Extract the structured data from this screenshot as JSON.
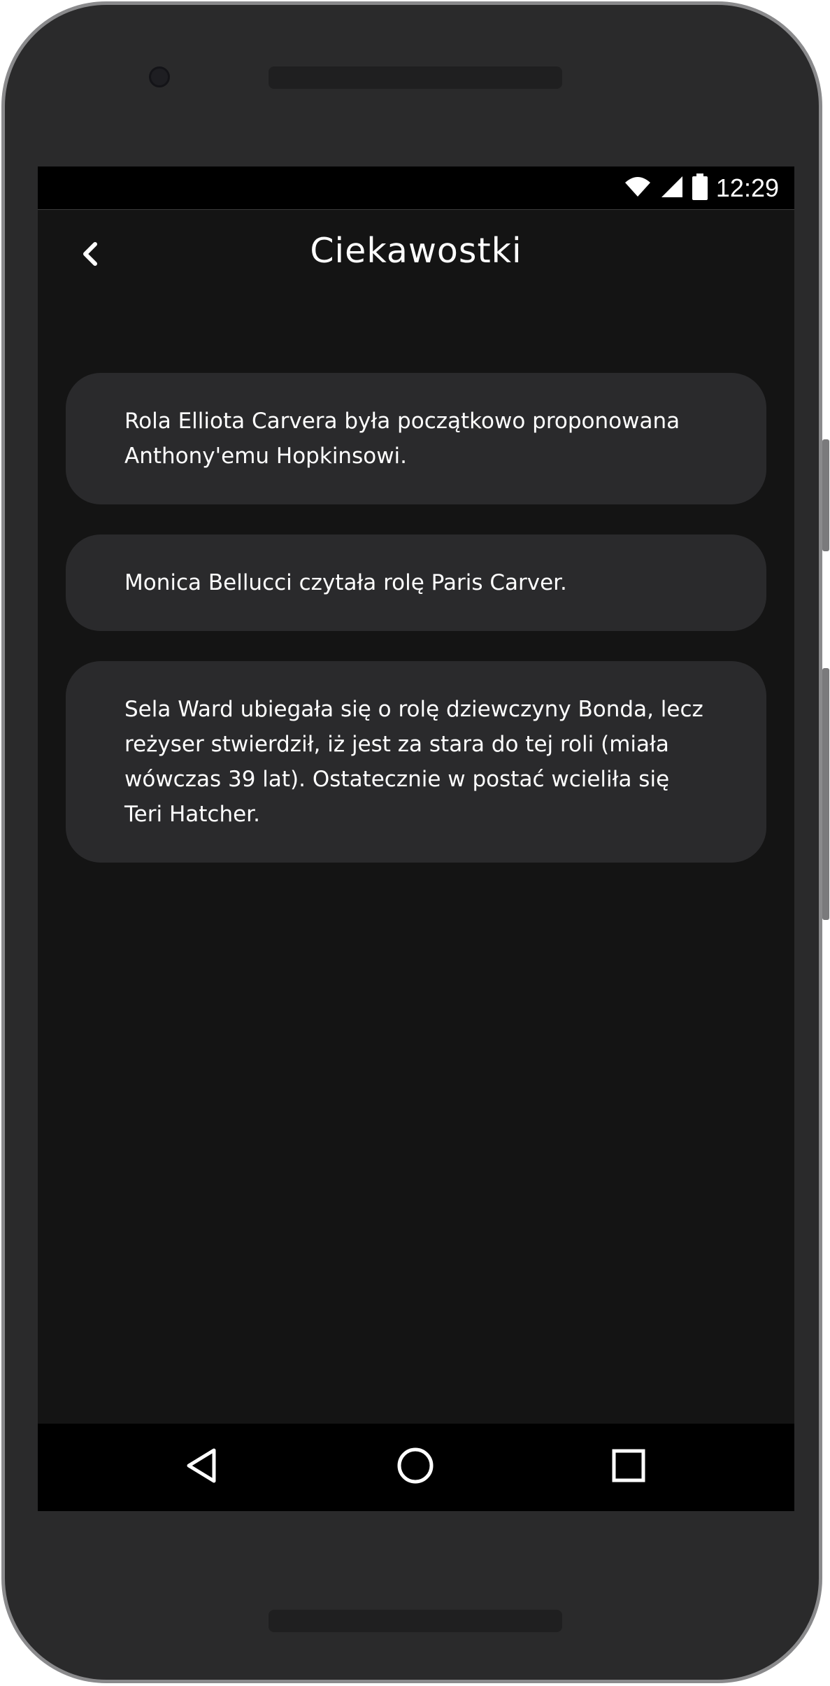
{
  "status_bar": {
    "time": "12:29",
    "icons": [
      "wifi-icon",
      "cell-signal-icon",
      "battery-icon"
    ]
  },
  "app_bar": {
    "title": "Ciekawostki",
    "back_icon": "chevron-left-icon"
  },
  "trivia": [
    {
      "text": "Rola Elliota Carvera była początkowo proponowana Anthony'emu Hopkinsowi."
    },
    {
      "text": "Monica Bellucci czytała rolę Paris Carver."
    },
    {
      "text": "Sela Ward ubiegała się o rolę dziewczyny Bonda, lecz reżyser stwierdził, iż jest za stara do tej roli (miała wówczas 39 lat). Ostatecznie w postać wcieliła się Teri Hatcher."
    }
  ],
  "nav_bar": {
    "icons": [
      "nav-back-icon",
      "nav-home-icon",
      "nav-recents-icon"
    ]
  },
  "colors": {
    "screen_background": "#141414",
    "card_background": "#2a2a2c",
    "text": "#ffffff",
    "phone_body": "#2a2a2b"
  }
}
